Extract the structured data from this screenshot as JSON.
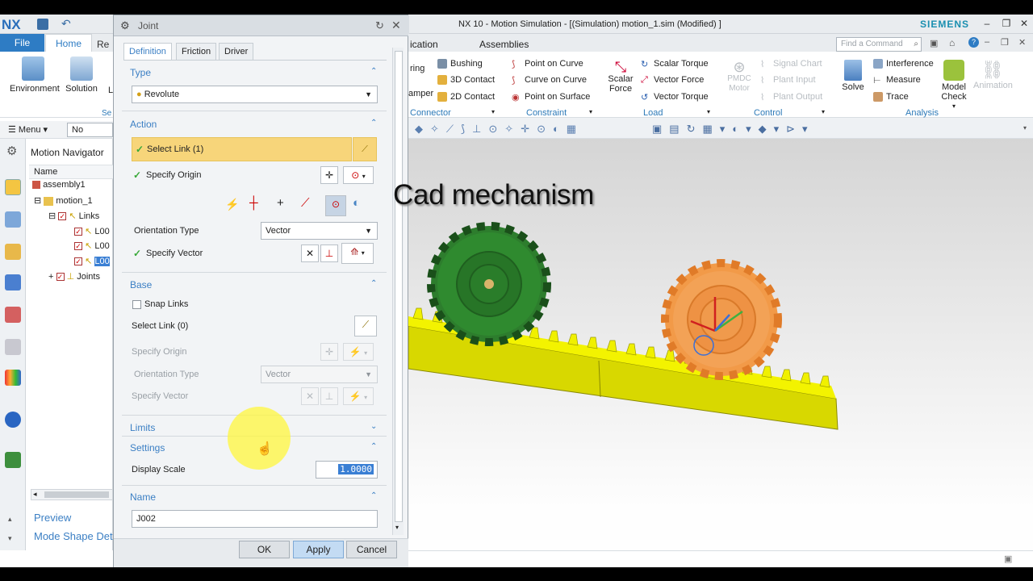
{
  "app": {
    "logo": "NX",
    "title": "NX 10 - Motion Simulation - [(Simulation) motion_1.sim (Modified) ]",
    "brand": "SIEMENS",
    "brand_color": "#1a8fb0",
    "accent_color": "#2e7cc4"
  },
  "left_ribbon": {
    "tabs": [
      "File",
      "Home",
      "Re"
    ],
    "buttons": [
      "Environment",
      "Solution",
      "L"
    ],
    "group_label": "Se",
    "menu_label": "Menu",
    "selection_filter": "No Selectio"
  },
  "navigator": {
    "title": "Motion Navigator",
    "column_name": "Name",
    "items": [
      "assembly1",
      "motion_1",
      "Links",
      "L00",
      "L00",
      "L00",
      "Joints"
    ],
    "preview_label": "Preview",
    "mode_shape_label": "Mode Shape Det"
  },
  "dialog": {
    "title": "Joint",
    "tabs": [
      "Definition",
      "Friction",
      "Driver"
    ],
    "type": {
      "header": "Type",
      "value": "Revolute"
    },
    "action": {
      "header": "Action",
      "select_link": "Select Link (1)",
      "specify_origin": "Specify Origin",
      "orientation_type_label": "Orientation Type",
      "orientation_type_value": "Vector",
      "specify_vector": "Specify Vector"
    },
    "base": {
      "header": "Base",
      "snap_links": "Snap Links",
      "select_link": "Select Link (0)",
      "specify_origin": "Specify Origin",
      "orientation_type_label": "Orientation Type",
      "orientation_type_value": "Vector",
      "specify_vector": "Specify Vector"
    },
    "limits_header": "Limits",
    "settings": {
      "header": "Settings",
      "display_scale_label": "Display Scale",
      "display_scale_value": "1.0000"
    },
    "name": {
      "header": "Name",
      "value": "J002"
    },
    "buttons": {
      "ok": "OK",
      "apply": "Apply",
      "cancel": "Cancel"
    }
  },
  "main_ribbon": {
    "menu_items": [
      "ication",
      "Assemblies"
    ],
    "search_placeholder": "Find a Command",
    "connector": {
      "items": [
        "Bushing",
        "3D Contact",
        "2D Contact"
      ],
      "partial": [
        "ring",
        "amper"
      ],
      "label": "Connector"
    },
    "constraint": {
      "items": [
        "Point on Curve",
        "Curve on Curve",
        "Point on Surface"
      ],
      "label": "Constraint"
    },
    "load": {
      "scalar_force": "Scalar Force",
      "items": [
        "Scalar Torque",
        "Vector Force",
        "Vector Torque"
      ],
      "label": "Load"
    },
    "control": {
      "pmdc_motor": "PMDC Motor",
      "items": [
        "Signal Chart",
        "Plant Input",
        "Plant Output"
      ],
      "label": "Control"
    },
    "analysis": {
      "solve": "Solve",
      "items": [
        "Interference",
        "Measure",
        "Trace"
      ],
      "model_check": "Model Check",
      "animation": "Animation",
      "label": "Analysis"
    }
  },
  "viewport": {
    "caption": "Cad mechanism",
    "gear_colors": {
      "left_gear": "#1f7a1f",
      "right_gear": "#f08a3c",
      "rack": "#e6e600"
    }
  }
}
